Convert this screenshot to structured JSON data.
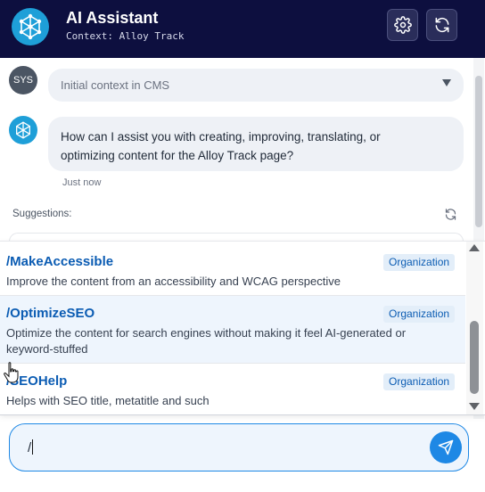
{
  "header": {
    "title": "AI Assistant",
    "context": "Context: Alloy Track",
    "logo_icon": "neural-network-icon",
    "settings_icon": "gear-icon",
    "refresh_icon": "refresh-icon"
  },
  "messages": {
    "system": {
      "avatar_label": "SYS",
      "text": "Initial context in CMS"
    },
    "assistant": {
      "text_line1": "How can I assist you with creating, improving, translating, or",
      "text_line2": "optimizing content for the Alloy Track page?",
      "timestamp": "Just now"
    }
  },
  "suggestions": {
    "label": "Suggestions:"
  },
  "commands": [
    {
      "name": "/MakeAccessible",
      "badge": "Organization",
      "desc_line1": "Improve the content from an accessibility and WCAG perspective",
      "desc_line2": ""
    },
    {
      "name": "/OptimizeSEO",
      "badge": "Organization",
      "desc_line1": "Optimize the content for search engines without making it feel AI-generated or",
      "desc_line2": "keyword-stuffed"
    },
    {
      "name": "/SEOHelp",
      "badge": "Organization",
      "desc_line1": "Helps with SEO title, metatitle and such",
      "desc_line2": ""
    }
  ],
  "input": {
    "value": "/"
  },
  "colors": {
    "header_bg": "#0d0f3f",
    "accent": "#1e88e5",
    "command_blue": "#0b5cb3"
  }
}
